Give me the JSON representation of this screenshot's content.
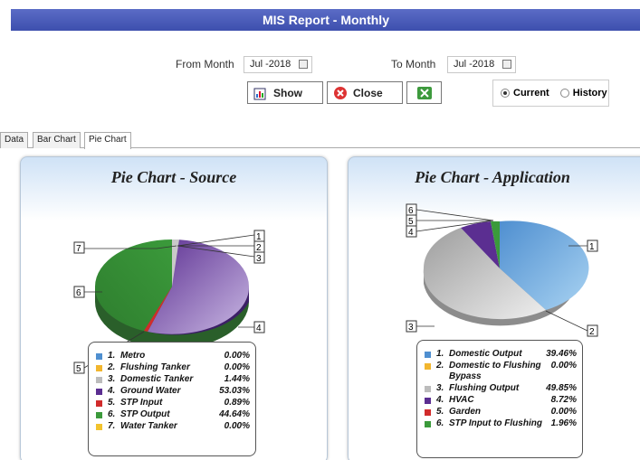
{
  "window": {
    "title": "MIS Report - Monthly"
  },
  "filters": {
    "from_label": "From Month",
    "from_value": "Jul -2018",
    "to_label": "To Month",
    "to_value": "Jul -2018",
    "show_label": "Show",
    "close_label": "Close",
    "radio_current": "Current",
    "radio_history": "History",
    "selected": "Current"
  },
  "tabs": [
    "Data",
    "Bar Chart",
    "Pie Chart"
  ],
  "active_tab": "Pie Chart",
  "chart_data": [
    {
      "type": "pie",
      "title": "Pie Chart - Source",
      "categories": [
        "Metro",
        "Flushing Tanker",
        "Domestic Tanker",
        "Ground Water",
        "STP Input",
        "STP Output",
        "Water Tanker"
      ],
      "values": [
        0.0,
        0.0,
        1.44,
        53.03,
        0.89,
        44.64,
        0.0
      ],
      "labels": [
        "1.",
        "2.",
        "3.",
        "4.",
        "5.",
        "6.",
        "7."
      ],
      "display": [
        "0.00%",
        "0.00%",
        "1.44%",
        "53.03%",
        "0.89%",
        "44.64%",
        "0.00%"
      ],
      "colors": [
        "#4f8fd0",
        "#f2b62e",
        "#bcbcbc",
        "#5b2e91",
        "#d12b2b",
        "#3b9a3b",
        "#f2c32e"
      ],
      "callouts": [
        "1",
        "2",
        "3",
        "4",
        "5",
        "6",
        "7"
      ]
    },
    {
      "type": "pie",
      "title": "Pie Chart - Application",
      "categories": [
        "Domestic Output",
        "Domestic to Flushing Bypass",
        "Flushing Output",
        "HVAC",
        "Garden",
        "STP Input to Flushing"
      ],
      "values": [
        39.46,
        0.0,
        49.85,
        8.72,
        0.0,
        1.96
      ],
      "labels": [
        "1.",
        "2.",
        "3.",
        "4.",
        "5.",
        "6."
      ],
      "display": [
        "39.46%",
        "0.00%",
        "49.85%",
        "8.72%",
        "0.00%",
        "1.96%"
      ],
      "colors": [
        "#4f8fd0",
        "#f2b62e",
        "#bcbcbc",
        "#5b2e91",
        "#d12b2b",
        "#3b9a3b"
      ],
      "callouts": [
        "1",
        "2",
        "3",
        "4",
        "5",
        "6"
      ]
    }
  ]
}
